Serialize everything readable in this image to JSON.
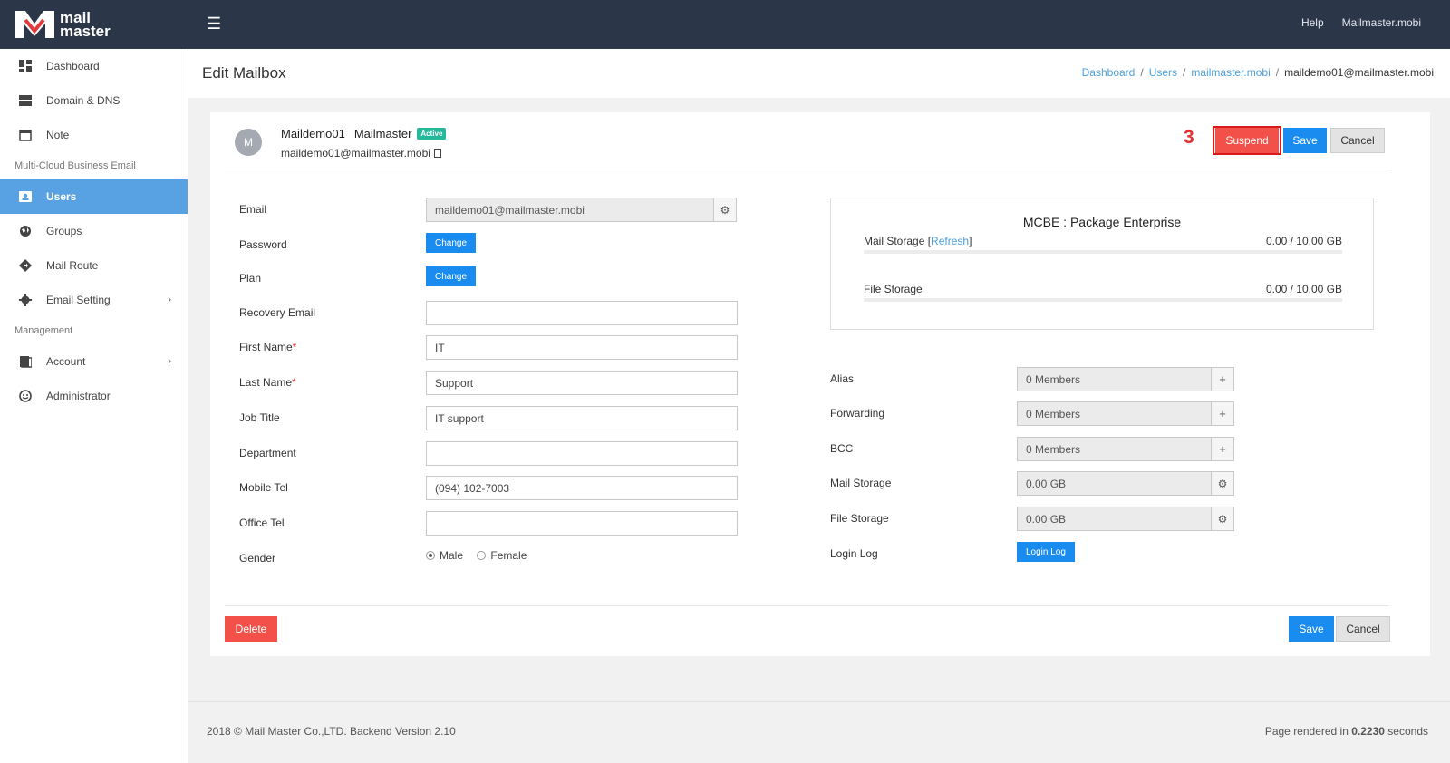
{
  "brand": {
    "line1": "mail",
    "line2": "master"
  },
  "topbar": {
    "help": "Help",
    "account": "Mailmaster.mobi"
  },
  "sidebar": {
    "items": [
      {
        "label": "Dashboard",
        "icon": "dashboard-icon"
      },
      {
        "label": "Domain & DNS",
        "icon": "server-icon"
      },
      {
        "label": "Note",
        "icon": "calendar-icon"
      }
    ],
    "section1": "Multi-Cloud Business Email",
    "items2": [
      {
        "label": "Users",
        "icon": "user-card-icon",
        "active": true
      },
      {
        "label": "Groups",
        "icon": "globe-icon"
      },
      {
        "label": "Mail Route",
        "icon": "route-icon"
      },
      {
        "label": "Email Setting",
        "icon": "gear-icon",
        "chevron": "›"
      }
    ],
    "section2": "Management",
    "items3": [
      {
        "label": "Account",
        "icon": "book-icon",
        "chevron": "›"
      },
      {
        "label": "Administrator",
        "icon": "smile-icon"
      }
    ]
  },
  "header": {
    "title": "Edit Mailbox",
    "breadcrumb": [
      "Dashboard",
      "Users",
      "mailmaster.mobi",
      "maildemo01@mailmaster.mobi"
    ]
  },
  "user": {
    "initial": "M",
    "first": "Maildemo01",
    "last": "Mailmaster",
    "status": "Active",
    "email": "maildemo01@mailmaster.mobi"
  },
  "annotation": "3",
  "buttons": {
    "suspend": "Suspend",
    "save": "Save",
    "cancel": "Cancel",
    "delete": "Delete",
    "change": "Change",
    "login_log": "Login Log"
  },
  "form": {
    "email_label": "Email",
    "email_value": "maildemo01@mailmaster.mobi",
    "password_label": "Password",
    "plan_label": "Plan",
    "recovery_label": "Recovery Email",
    "recovery_value": "",
    "first_name_label": "First Name",
    "first_name_value": "IT",
    "last_name_label": "Last Name",
    "last_name_value": "Support",
    "job_title_label": "Job Title",
    "job_title_value": "IT support",
    "department_label": "Department",
    "department_value": "",
    "mobile_label": "Mobile Tel",
    "mobile_value": "(094) 102-7003",
    "office_label": "Office Tel",
    "office_value": "",
    "gender_label": "Gender",
    "gender_male": "Male",
    "gender_female": "Female",
    "gender_selected": "Male",
    "required_mark": "*"
  },
  "package": {
    "title": "MCBE : Package Enterprise",
    "mail_storage_label": "Mail Storage",
    "refresh_link": "Refresh",
    "mail_storage_value": "0.00 / 10.00 GB",
    "file_storage_label": "File Storage",
    "file_storage_value": "0.00 / 10.00 GB"
  },
  "right_form": {
    "alias_label": "Alias",
    "alias_value": "0 Members",
    "forwarding_label": "Forwarding",
    "forwarding_value": "0 Members",
    "bcc_label": "BCC",
    "bcc_value": "0 Members",
    "mail_storage_label": "Mail Storage",
    "mail_storage_value": "0.00 GB",
    "file_storage_label": "File Storage",
    "file_storage_value": "0.00 GB",
    "login_log_label": "Login Log"
  },
  "footer": {
    "left": "2018 © Mail Master Co.,LTD. Backend Version 2.10",
    "right_prefix": "Page rendered in",
    "right_value": "0.2230",
    "right_suffix": "seconds"
  },
  "colors": {
    "topbar": "#2b3648",
    "accent": "#1a8cf0",
    "active_nav": "#58a1e2",
    "danger": "#f4504a",
    "badge": "#26b89a"
  }
}
